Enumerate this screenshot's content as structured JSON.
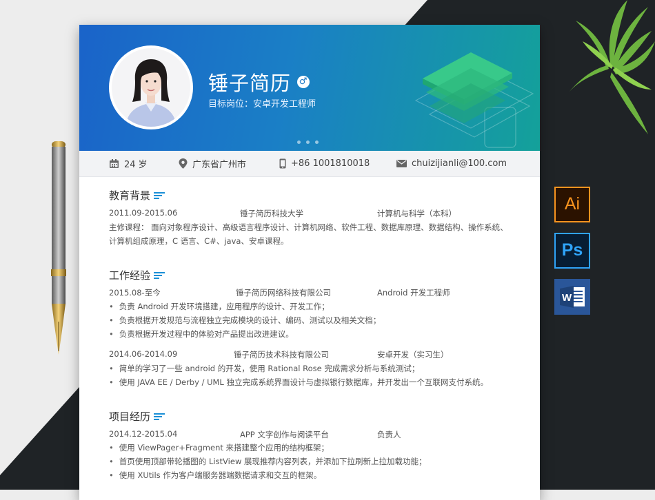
{
  "header": {
    "name": "锤子简历",
    "gender_icon": "male-symbol-icon",
    "target": "目标岗位：安卓开发工程师"
  },
  "info": {
    "age": "24 岁",
    "location": "广东省广州市",
    "phone": "+86 1001810018",
    "email": "chuizijianli@100.com"
  },
  "education": {
    "title": "教育背景",
    "period": "2011.09-2015.06",
    "school": "锤子简历科技大学",
    "major": "计算机与科学（本科）",
    "courses_line1": "主修课程：  面向对象程序设计、高级语言程序设计、计算机网络、软件工程、数据库原理、数据结构、操作系统、",
    "courses_line2": "计算机组成原理，C 语言、C#、java、安卓课程。"
  },
  "work": {
    "title": "工作经验",
    "jobs": [
      {
        "period": "2015.08-至今",
        "company": "锤子简历网络科技有限公司",
        "role": "Android 开发工程师",
        "bullets": [
          "负责 Android 开发环境搭建，应用程序的设计、开发工作；",
          "负责根据开发规范与流程独立完成模块的设计、编码、测试以及相关文档；",
          "负责根据开发过程中的体验对产品提出改进建议。"
        ]
      },
      {
        "period": "2014.06-2014.09",
        "company": "锤子简历技术科技有限公司",
        "role": "安卓开发（实习生）",
        "bullets": [
          "简单的学习了一些 android 的开发，使用  Rational Rose 完成需求分析与系统测试；",
          "使用 JAVA EE / Derby / UML 独立完成系统界面设计与虚拟银行数据库，并开发出一个互联网支付系统。"
        ]
      }
    ]
  },
  "project": {
    "title": "项目经历",
    "period": "2014.12-2015.04",
    "name": "APP 文字创作与阅读平台",
    "role": "负责人",
    "bullets": [
      "使用 ViewPager+Fragment 来搭建整个应用的结构框架；",
      "首页使用顶部带轮播图的 ListView 展现推荐内容列表，并添加下拉刷新上拉加载功能；",
      "使用 XUtils 作为客户端服务器端数据请求和交互的框架。"
    ]
  },
  "apps": {
    "ai_label": "Ai",
    "ps_label": "Ps",
    "word_label": "W"
  },
  "colors": {
    "banner_start": "#1a63c9",
    "banner_end": "#14a19a",
    "accent": "#1a78c6"
  }
}
